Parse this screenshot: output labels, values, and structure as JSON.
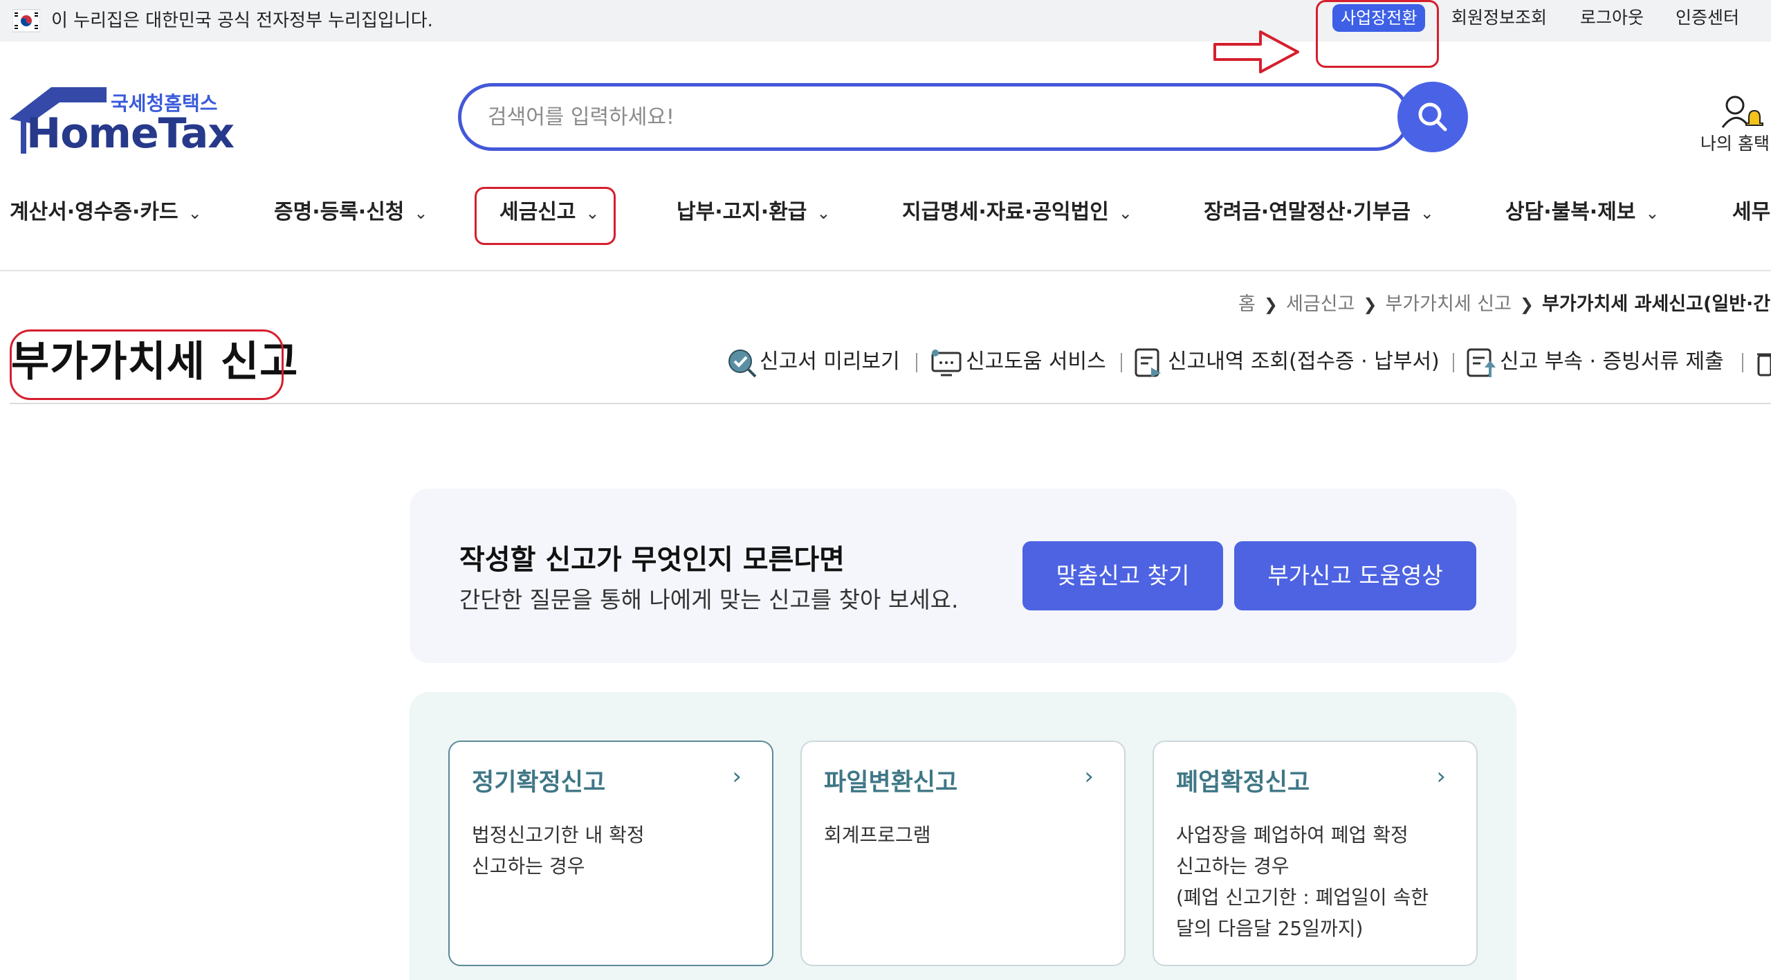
{
  "gov_banner": {
    "text": "이 누리집은 대한민국 공식 전자정부 누리집입니다."
  },
  "utility_nav": {
    "switch_business": "사업장전환",
    "member_info": "회원정보조회",
    "logout": "로그아웃",
    "cert_center": "인증센터"
  },
  "logo": {
    "sub": "국세청홈택스",
    "main": "HomeTax"
  },
  "search": {
    "placeholder": "검색어를 입력하세요!",
    "value": ""
  },
  "my_hometax": {
    "label": "나의 홈택"
  },
  "gnb": [
    {
      "label": "계산서·영수증·카드"
    },
    {
      "label": "증명·등록·신청"
    },
    {
      "label": "세금신고"
    },
    {
      "label": "납부·고지·환급"
    },
    {
      "label": "지급명세·자료·공익법인"
    },
    {
      "label": "장려금·연말정산·기부금"
    },
    {
      "label": "상담·불복·제보"
    },
    {
      "label": "세무"
    }
  ],
  "breadcrumb": [
    "홈",
    "세금신고",
    "부가가치세 신고",
    "부가가치세 과세신고(일반·간"
  ],
  "page_title": "부가가치세 신고",
  "quick_links": [
    {
      "label": "신고서 미리보기",
      "icon": "search-check-icon"
    },
    {
      "label": "신고도움 서비스",
      "icon": "monitor-help-icon"
    },
    {
      "label": "신고내역 조회(접수증 · 납부서)",
      "icon": "document-history-icon"
    },
    {
      "label": "신고 부속 · 증빙서류 제출",
      "icon": "document-upload-icon"
    }
  ],
  "banner": {
    "title": "작성할 신고가 무엇인지 모른다면",
    "subtitle": "간단한 질문을 통해 나에게 맞는 신고를 찾아 보세요.",
    "btn_custom": "맞춤신고 찾기",
    "btn_video": "부가신고 도움영상"
  },
  "cards": [
    {
      "title": "정기확정신고",
      "desc": "법정신고기한 내 확정\n신고하는 경우"
    },
    {
      "title": "파일변환신고",
      "desc": "회계프로그램"
    },
    {
      "title": "폐업확정신고",
      "desc": "사업장을 폐업하여 폐업 확정\n신고하는 경우\n(폐업 신고기한 : 폐업일이 속한\n달의 다음달 25일까지)"
    }
  ],
  "colors": {
    "brand_blue": "#4a63e6",
    "logo_navy": "#26398b",
    "card_title": "#3f7786",
    "annotation_red": "#d51f2e"
  }
}
